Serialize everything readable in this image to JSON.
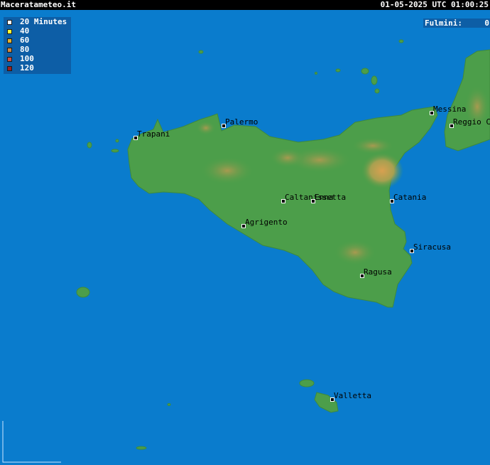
{
  "header": {
    "site": "Maceratameteo.it",
    "timestamp": "01-05-2025 UTC 01:00:25"
  },
  "legend": {
    "items": [
      {
        "label": "20 Minutes",
        "color": "#ffffff"
      },
      {
        "label": "40",
        "color": "#ffff33"
      },
      {
        "label": "60",
        "color": "#e0b030"
      },
      {
        "label": "80",
        "color": "#d08840"
      },
      {
        "label": "100",
        "color": "#d05040"
      },
      {
        "label": "120",
        "color": "#a02020"
      }
    ]
  },
  "counter": {
    "label": "Fulmini:",
    "value": "0"
  },
  "cities": {
    "palermo": "Palermo",
    "trapani": "Trapani",
    "messina": "Messina",
    "reggio": "Reggio Ca",
    "caltanissetta": "Caltanissetta",
    "enna": "Enna",
    "catania": "Catania",
    "agrigento": "Agrigento",
    "siracusa": "Siracusa",
    "ragusa": "Ragusa",
    "valletta": "Valletta"
  },
  "colors": {
    "sea": "#0a7ccd",
    "land": "#4a9e4a",
    "relief": "#b89a50",
    "panel": "#0d5ea6"
  }
}
